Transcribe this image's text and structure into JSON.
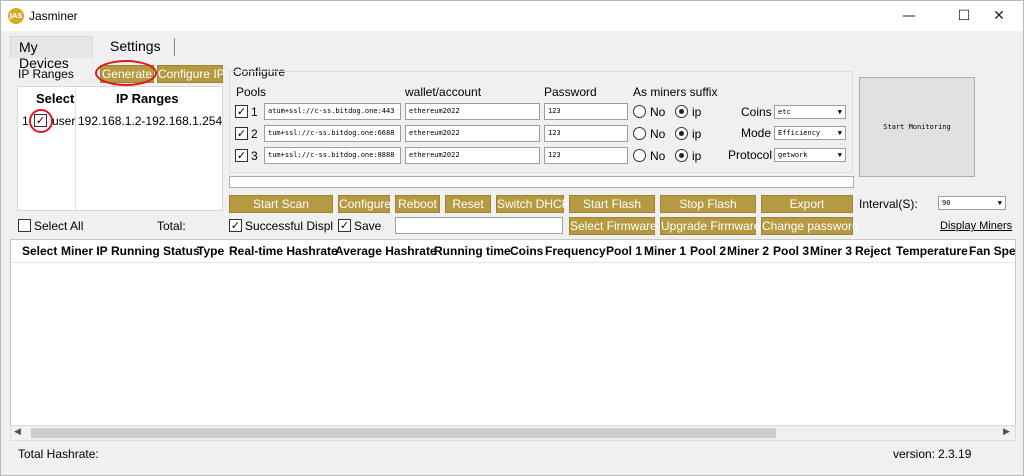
{
  "window": {
    "title": "Jasminer",
    "icon_text": "JAS",
    "controls": [
      "minimize-icon",
      "maximize-icon",
      "close-icon"
    ]
  },
  "tabs": [
    {
      "label": "My Devices",
      "active": true
    },
    {
      "label": "Settings",
      "active": false
    }
  ],
  "ip_ranges": {
    "section_label": "IP Ranges",
    "generate_label": "Generate",
    "configure_ip_label": "Configure IP",
    "headers": {
      "select": "Select",
      "ranges": "IP Ranges"
    },
    "row": {
      "index": "1",
      "checked": true,
      "user": "user",
      "range": "192.168.1.2-192.168.1.254"
    }
  },
  "configure": {
    "section_label": "Configure",
    "headers": {
      "pools": "Pools",
      "wallet": "wallet/account",
      "password": "Password",
      "suffix": "As miners suffix"
    },
    "pools": [
      {
        "num": "1",
        "checked": true,
        "url": "atum+ssl://c-ss.bitdog.one:443",
        "wallet": "ethereum2022",
        "password": "123",
        "suffix": "ip"
      },
      {
        "num": "2",
        "checked": true,
        "url": "tum+ssl://c-ss.bitdog.one:6688",
        "wallet": "ethereum2022",
        "password": "123",
        "suffix": "ip"
      },
      {
        "num": "3",
        "checked": true,
        "url": "tum+ssl://c-ss.bitdog.one:8888",
        "wallet": "ethereum2022",
        "password": "123",
        "suffix": "ip"
      }
    ],
    "radio_labels": {
      "no": "No",
      "ip": "ip"
    },
    "coins": {
      "label": "Coins",
      "value": "etc"
    },
    "mode": {
      "label": "Mode",
      "value": "Efficiency"
    },
    "protocol": {
      "label": "Protocol",
      "value": "getwork"
    },
    "start_monitoring_label": "Start Monitoring"
  },
  "actions": {
    "start_scan": "Start Scan",
    "configure": "Configure",
    "reboot": "Reboot",
    "reset": "Reset",
    "switch_dhcp": "Switch DHCP",
    "start_flash": "Start Flash",
    "stop_flash": "Stop Flash",
    "export": "Export",
    "select_firmware": "Select Firmware",
    "upgrade_firmware": "Upgrade Firmware",
    "change_password": "Change password",
    "interval_label": "Interval(S):",
    "interval_value": "90",
    "display_miners": "Display Miners"
  },
  "filters": {
    "select_all": "Select All",
    "select_all_checked": false,
    "total": "Total:",
    "successful_display": "Successful Display",
    "successful_display_checked": true,
    "save": "Save",
    "save_checked": true
  },
  "table": {
    "columns": [
      "Select",
      "Miner IP",
      "Running Status",
      "Type",
      "Real-time Hashrate",
      "Average Hashrate",
      "Running time",
      "Coins",
      "Frequency",
      "Pool 1",
      "Miner 1",
      "Pool 2",
      "Miner 2",
      "Pool 3",
      "Miner 3",
      "Reject",
      "Temperature",
      "Fan Speed"
    ],
    "rows": []
  },
  "footer": {
    "total_hashrate": "Total Hashrate:",
    "version_label": "version:",
    "version_value": "2.3.19"
  },
  "colors": {
    "accent_button": "#b59a42",
    "highlight_circle": "#e0161c"
  }
}
